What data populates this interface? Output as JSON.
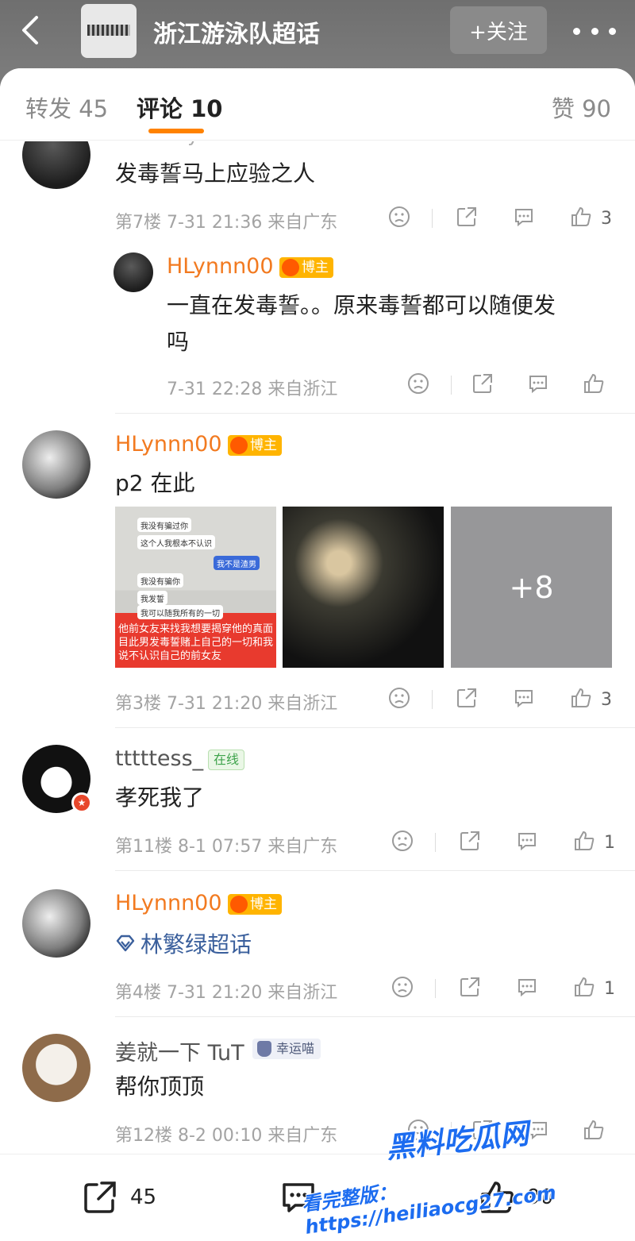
{
  "header": {
    "group_title": "浙江游泳队超话",
    "follow_label": "+关注"
  },
  "tabs": {
    "repost": "转发 45",
    "comments": "评论 10",
    "likes": "赞 90"
  },
  "comments": [
    {
      "username_partial": "NAxxxxy",
      "text": "发毒誓马上应验之人",
      "meta": "第7楼 7-31 21:36 来自广东",
      "likes": "3",
      "reply": {
        "username": "HLynnn00",
        "badge": "博主",
        "text_line1": "一直在发毒誓。。原来毒誓都可以随便发",
        "text_line2": "吗",
        "meta": "7-31 22:28 来自浙江"
      }
    },
    {
      "username": "HLynnn00",
      "badge": "博主",
      "text": "p2 在此",
      "images": {
        "img1_bubbles": [
          "我没有骗过你",
          "这个人我根本不认识",
          "我不是渣男",
          "我没有骗你",
          "我发誓",
          "我可以随我所有的一切"
        ],
        "img1_caption": "他前女友来找我想要揭穿他的真面目此男发毒誓赌上自己的一切和我说不认识自己的前女友",
        "more_count": "+8"
      },
      "meta": "第3楼 7-31 21:20 来自浙江",
      "likes": "3"
    },
    {
      "username": "tttttess_",
      "badge": "在线",
      "text": "孝死我了",
      "meta": "第11楼 8-1 07:57 来自广东",
      "likes": "1"
    },
    {
      "username": "HLynnn00",
      "badge": "博主",
      "topic": "林繁绿超话",
      "meta": "第4楼 7-31 21:20 来自浙江",
      "likes": "1"
    },
    {
      "username": "姜就一下 TuT",
      "badge": "幸运喵",
      "text": "帮你顶顶",
      "meta": "第12楼 8-2 00:10 来自广东"
    }
  ],
  "bottom_bar": {
    "repost_count": "45",
    "like_count": "90"
  },
  "watermark": {
    "line1": "黑料吃瓜网",
    "line2": "看完整版：https://heiliaocg27.com"
  },
  "colors": {
    "accent_orange": "#ff8200",
    "username_orange": "#f27a20",
    "meta_gray": "#a3a3a3"
  }
}
